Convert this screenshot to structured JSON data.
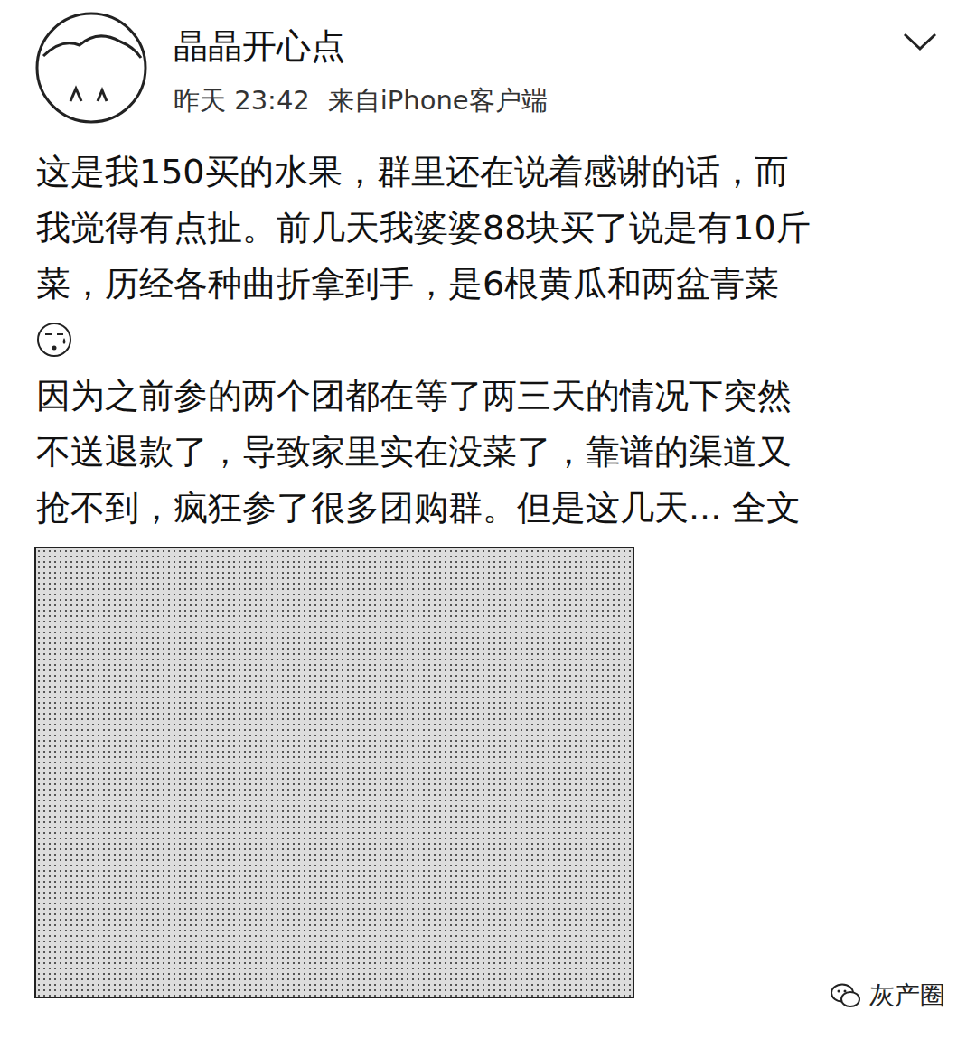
{
  "post": {
    "author": "晶晶开心点",
    "time": "昨天 23:42",
    "source": "来自iPhone客户端",
    "lines": [
      {
        "kind": "text",
        "text": "这是我150买的水果，群里还在说着感谢的话，而"
      },
      {
        "kind": "text",
        "text": "我觉得有点扯。前几天我婆婆88块买了说是有10斤"
      },
      {
        "kind": "text",
        "text": "菜，历经各种曲折拿到手，是6根黄瓜和两盆青菜"
      },
      {
        "kind": "emoji",
        "text": ""
      },
      {
        "kind": "text",
        "text": "因为之前参的两个团都在等了两三天的情况下突然"
      },
      {
        "kind": "text",
        "text": "不送退款了，导致家里实在没菜了，靠谱的渠道又"
      },
      {
        "kind": "text",
        "text": "抢不到，疯狂参了很多团购群。但是这几天..."
      }
    ],
    "more_link": "全文"
  },
  "watermark": "灰产圈"
}
